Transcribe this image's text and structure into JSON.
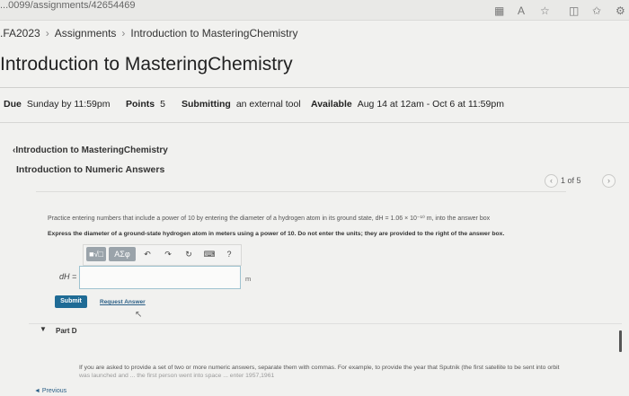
{
  "browser": {
    "url_fragment": "...0099/assignments/42654469"
  },
  "breadcrumb": {
    "course": ".FA2023",
    "assignments": "Assignments",
    "current": "Introduction to MasteringChemistry"
  },
  "page": {
    "title": "Introduction to MasteringChemistry"
  },
  "meta": {
    "due_label": "Due",
    "due_value": "Sunday by 11:59pm",
    "points_label": "Points",
    "points_value": "5",
    "submitting_label": "Submitting",
    "submitting_value": "an external tool",
    "available_label": "Available",
    "available_value": "Aug 14 at 12am - Oct 6 at 11:59pm"
  },
  "assignment": {
    "back_link": "‹Introduction to MasteringChemistry",
    "subtitle": "Introduction to Numeric Answers",
    "pager": "1 of 5",
    "question_line1": "Practice entering numbers that include a power of 10 by entering the diameter of a hydrogen atom in its ground state, dH = 1.06 × 10⁻¹⁰ m, into the answer box",
    "question_line2": "Express the diameter of a ground-state hydrogen atom in meters using a power of 10. Do not enter the units; they are provided to the right of the answer box.",
    "answer_label": "dH =",
    "unit": "m",
    "answer_value": "",
    "submit_label": "Submit",
    "request_answer_label": "Request Answer",
    "toolbar": {
      "templates": "■√□",
      "greek": "ΑΣφ",
      "undo": "↶",
      "redo": "↷",
      "reset": "↻",
      "keyboard": "⌨",
      "help": "?"
    }
  },
  "part_d": {
    "label": "Part D",
    "text": "If you are asked to provide a set of two or more numeric answers, separate them with commas. For example, to provide the year that Sputnik (the first satellite to be sent into orbit",
    "text2": "was launched and ... the first person went into space ... enter 1957,1961"
  },
  "nav": {
    "previous": "◄ Previous"
  }
}
